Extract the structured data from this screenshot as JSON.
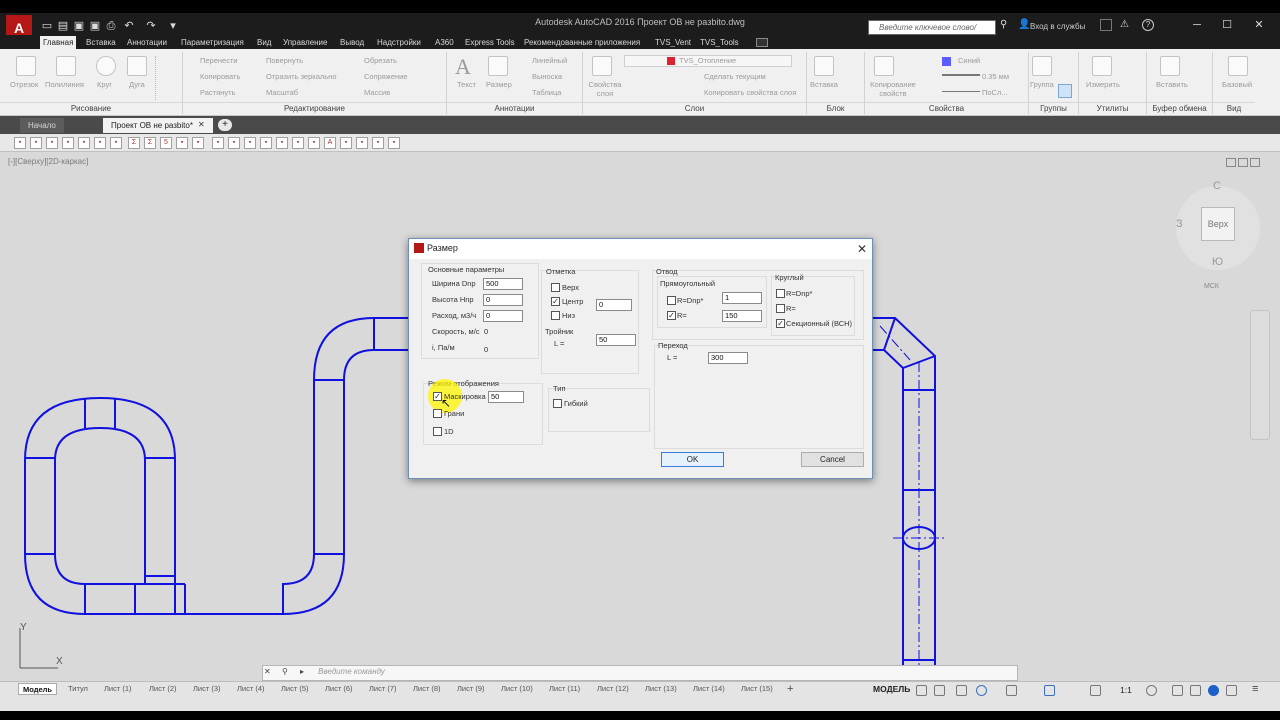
{
  "title": "Autodesk AutoCAD 2016     Проект ОВ не разbito.dwg",
  "app_logo": "A",
  "search": {
    "placeholder": "Введите ключевое слово/фразу"
  },
  "signin": "Вход в службы",
  "ribbon_tabs": [
    "Главная",
    "Вставка",
    "Аннотации",
    "Параметризация",
    "Вид",
    "Управление",
    "Вывод",
    "Надстройки",
    "A360",
    "Express Tools",
    "Рекомендованные приложения",
    "TVS_Vent",
    "TVS_Tools"
  ],
  "ribbon": {
    "draw_tools": [
      "Отрезок",
      "Полилиния",
      "Круг",
      "Дуга"
    ],
    "modify_tools": [
      "Перенести",
      "Повернуть",
      "Обрезать",
      "Копировать",
      "Отразить зеркально",
      "Сопряжение",
      "Растянуть",
      "Масштаб",
      "Массив"
    ],
    "annot_tools": [
      "Текст",
      "Размер",
      "Линейный",
      "Выноска",
      "Таблица"
    ],
    "layer_props": "Свойства слоя",
    "layer_name": "TVS_Отопление",
    "layer_tools": [
      "Сделать текущим",
      "Копировать свойства слоя"
    ],
    "block_tools": [
      "Вставка"
    ],
    "props_copy": "Копирование свойств",
    "color": "Синий",
    "lineweight": "0.35 мм",
    "linetype": "ПоСл...",
    "group_label": "Группа",
    "measure_label": "Измерить",
    "paste_label": "Вставить",
    "base_label": "Базовый",
    "groups": [
      "Рисование",
      "Редактирование",
      "Аннотации",
      "Слои",
      "Блок",
      "Свойства",
      "Группы",
      "Утилиты",
      "Буфер обмена",
      "Вид"
    ]
  },
  "doc_tabs": {
    "start": "Начало",
    "current": "Проект ОВ не разbito*"
  },
  "viewport_label": "[-][Сверху][2D-каркас]",
  "viewcube": {
    "n": "С",
    "s": "Ю",
    "w": "З",
    "face": "Верх",
    "ucs": "МСК"
  },
  "ucs_icon": {
    "x": "X",
    "y": "Y"
  },
  "command_placeholder": "Введите команду",
  "layout_tabs": [
    "Модель",
    "Титул",
    "Лист (1)",
    "Лист (2)",
    "Лист (3)",
    "Лист (4)",
    "Лист (5)",
    "Лист (6)",
    "Лист (7)",
    "Лист (8)",
    "Лист (9)",
    "Лист (10)",
    "Лист (11)",
    "Лист (12)",
    "Лист (13)",
    "Лист (14)",
    "Лист (15)"
  ],
  "status_mode": "МОДЕЛЬ",
  "status_scale": "1:1",
  "dialog": {
    "title": "Размер",
    "basic": {
      "heading": "Основные параметры",
      "width_label": "Ширина Dnp",
      "width_value": "500",
      "height_label": "Высота Hnp",
      "height_value": "0",
      "flow_label": "Расход, м3/ч",
      "flow_value": "0",
      "speed_label": "Скорость, м/с",
      "speed_value": "0",
      "i_label": "i,  Па/м",
      "i_value": "0"
    },
    "elevation": {
      "heading": "Отметка",
      "top": "Верх",
      "center": "Центр",
      "bottom": "Низ",
      "center_value": "0",
      "tee_heading": "Тройник",
      "tee_l": "L =",
      "tee_value": "50"
    },
    "bend": {
      "heading": "Отвод",
      "rect_heading": "Прямоугольный",
      "rect_r_dnp": "R=Dnp*",
      "rect_r_dnp_value": "1",
      "rect_r": "R=",
      "rect_r_value": "150",
      "round_heading": "Круглый",
      "round_r_dnp": "R=Dnp*",
      "round_r": "R=",
      "round_sectional": "Секционный (ВСН)"
    },
    "transition": {
      "heading": "Переход",
      "l": "L =",
      "value": "300"
    },
    "display": {
      "heading": "Режим отображения",
      "masking": "Маскировка",
      "masking_value": "50",
      "edges": "Грани",
      "one_d": "1D"
    },
    "type": {
      "heading": "Тип",
      "flexible": "Гибкий"
    },
    "ok": "OK",
    "cancel": "Cancel"
  },
  "colors": {
    "pipe": "#1010e0",
    "canvas": "#d9d9d9",
    "titlebar": "#1c1c1c"
  }
}
